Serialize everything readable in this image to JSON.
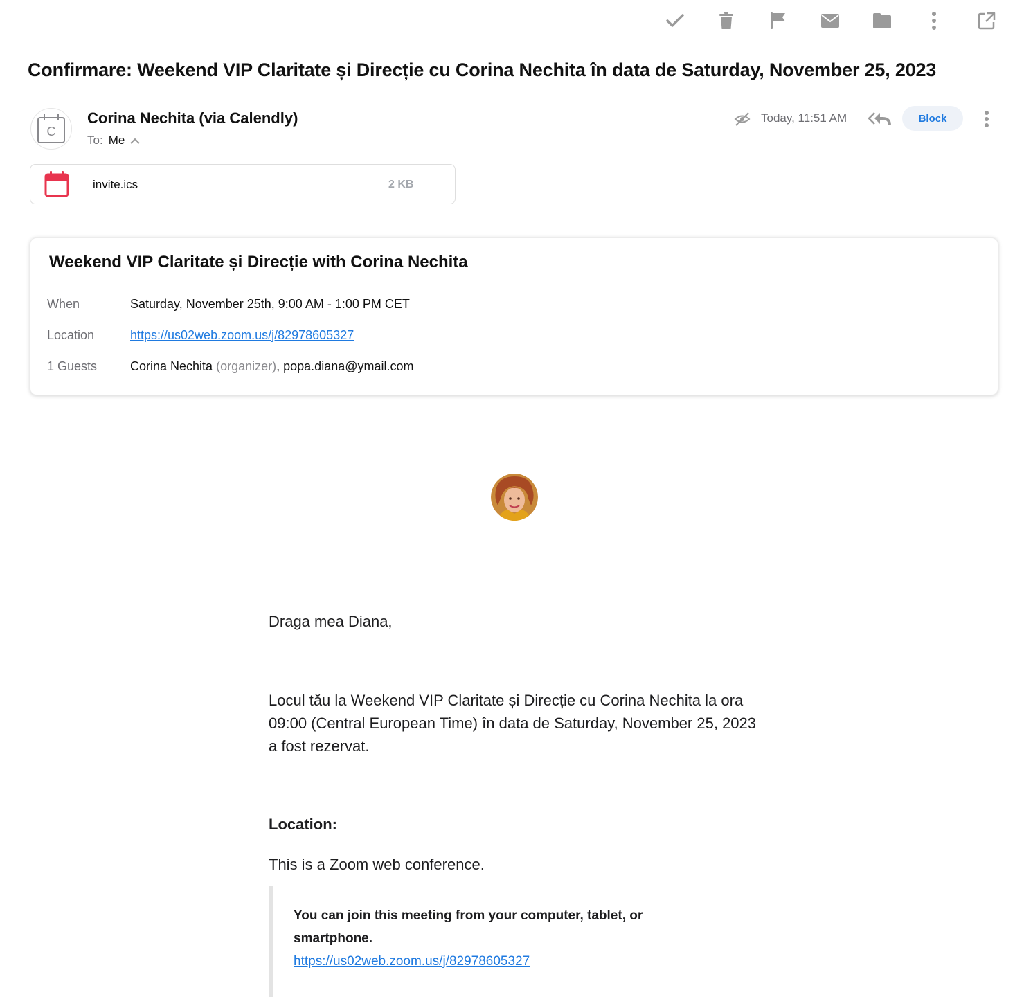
{
  "colors": {
    "accent": "#1f7ae0",
    "icon_gray": "#9a9a9a",
    "calendar_red": "#e8344e",
    "block_bg": "#eef2f8"
  },
  "toolbar": {
    "icons": [
      "check-icon",
      "trash-icon",
      "flag-icon",
      "envelope-icon",
      "folder-icon",
      "more-vertical-icon",
      "open-external-icon"
    ]
  },
  "message": {
    "subject": "Confirmare: Weekend VIP Claritate și Direcție cu Corina Nechita în data de Saturday, November 25, 2023",
    "sender_name": "Corina Nechita (via Calendly)",
    "sender_avatar_letter": "C",
    "to_label": "To:",
    "to_value": "Me",
    "timestamp": "Today, 11:51 AM",
    "block_label": "Block"
  },
  "attachment": {
    "name": "invite.ics",
    "size": "2 KB"
  },
  "event": {
    "title": "Weekend VIP Claritate și Direcție with Corina Nechita",
    "when_label": "When",
    "when_value": "Saturday, November 25th, 9:00 AM - 1:00 PM CET",
    "location_label": "Location",
    "location_value": "https://us02web.zoom.us/j/82978605327",
    "guests_label": "1 Guests",
    "guest_organizer": "Corina Nechita",
    "organizer_tag": "(organizer)",
    "guest_separator": ",",
    "guest_email": "popa.diana@ymail.com"
  },
  "body": {
    "greeting": "Draga mea Diana,",
    "paragraph": "Locul tău la Weekend VIP Claritate și Direcție cu Corina Nechita la ora 09:00 (Central European Time) în data de Saturday, November 25, 2023 a fost rezervat.",
    "location_heading": "Location:",
    "zoom_info": "This is a Zoom web conference.",
    "join_text": "You can join this meeting from your computer, tablet, or smartphone.",
    "join_link": "https://us02web.zoom.us/j/82978605327"
  }
}
